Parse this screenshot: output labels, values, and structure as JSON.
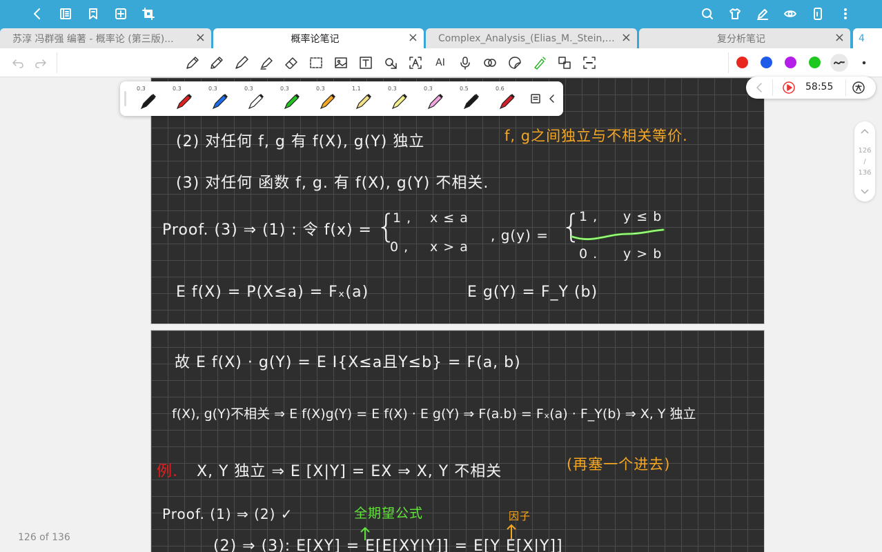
{
  "tabs": [
    {
      "label": "苏淳 冯群强 编著 - 概率论 (第三版)...",
      "active": false
    },
    {
      "label": "概率论笔记",
      "active": true
    },
    {
      "label": "Complex_Analysis_(Elias_M._Stein,_...",
      "active": false
    },
    {
      "label": "复分析笔记",
      "active": false
    }
  ],
  "tab_count": "4",
  "tab_close": "×",
  "toolbar": {
    "text_tool": "AI",
    "colors": [
      "#e8281e",
      "#1e5be8",
      "#b31ee8",
      "#1ec81e"
    ]
  },
  "pens": [
    {
      "width": "0.3",
      "color": "#1a1a1a"
    },
    {
      "width": "0.3",
      "color": "#e02020"
    },
    {
      "width": "0.3",
      "color": "#1e6be8"
    },
    {
      "width": "0.3",
      "color": "#ffffff"
    },
    {
      "width": "0.3",
      "color": "#22c422"
    },
    {
      "width": "0.3",
      "color": "#f5a623"
    },
    {
      "width": "1.1",
      "color": "#f3e28a"
    },
    {
      "width": "0.3",
      "color": "#f2ef8c"
    },
    {
      "width": "0.3",
      "color": "#f2a6e0"
    },
    {
      "width": "0.5",
      "color": "#1a1a1a"
    },
    {
      "width": "0.6",
      "color": "#d01e2a"
    }
  ],
  "timer": {
    "time": "58:55"
  },
  "page_indicator": {
    "current": "126",
    "slash": "/",
    "total": "136"
  },
  "page_count": "126 of 136",
  "notes": {
    "line_2": "(2) 对任何 f, g 有 f(X), g(Y) 独立",
    "remark_orange": "f, g之间独立与不相关等价.",
    "line_3": "(3) 对任何 函数 f, g. 有 f(X), g(Y) 不相关.",
    "proof_head": "Proof. (3) ⇒ (1) :  令 f(x) =",
    "case_1": "1 ,",
    "case_1_cond": "x ≤ a",
    "case_0": "0 ,",
    "case_0_cond": "x > a",
    "g_def": ", g(y) =",
    "g_case_1": "1 ,",
    "g_case_1_cond": "y ≤ b",
    "g_case_0": "0 .",
    "g_case_0_cond": "y > b",
    "ef": "E f(X) =  P(X≤a) = Fₓ(a)",
    "eg": "E g(Y) = F_Y (b)",
    "gu": "故 E f(X) · g(Y) = E I{X≤a且Y≤b} = F(a, b)",
    "uncorr": "f(X), g(Y)不相关 ⇒ E f(X)g(Y) = E f(X) · E g(Y) ⇒ F(a.b) = Fₓ(a) · F_Y(b) ⇒ X, Y 独立",
    "li": "例.",
    "li_text": "X, Y 独立  ⇒  E [X|Y] = EX  ⇒  X, Y 不相关",
    "li_note": "(再塞一个进去)",
    "proof2": "Proof.  (1) ⇒ (2)  ✓",
    "green_note": "全期望公式",
    "orange_note": "因子",
    "last_line": "(2) ⇒ (3):  E[XY] = E[E[XY|Y]] = E[Y E[X|Y]]"
  }
}
